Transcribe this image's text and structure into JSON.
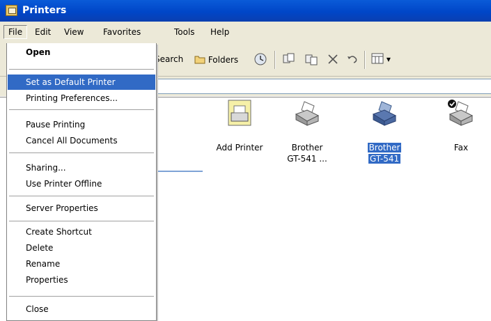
{
  "window": {
    "title": "Printers"
  },
  "menubar": [
    "File",
    "Edit",
    "View",
    "Favorites",
    "Tools",
    "Help"
  ],
  "toolbar": {
    "search": "Search",
    "folders": "Folders",
    "view_dropdown": "▾"
  },
  "file_menu": {
    "groups": [
      [
        "Open"
      ],
      [
        "Set as Default Printer",
        "Printing Preferences..."
      ],
      [
        "Pause Printing",
        "Cancel All Documents"
      ],
      [
        "Sharing...",
        "Use Printer Offline"
      ],
      [
        "Server Properties"
      ],
      [
        "Create Shortcut",
        "Delete",
        "Rename",
        "Properties"
      ],
      [
        "Close"
      ]
    ],
    "highlighted": "Set as Default Printer"
  },
  "items": [
    {
      "name": "Add Printer",
      "icon": "add-printer-icon"
    },
    {
      "name": "Brother GT-541 ...",
      "line1": "Brother",
      "line2": "GT-541 ...",
      "icon": "printer-icon"
    },
    {
      "name": "Brother GT-541",
      "line1": "Brother",
      "line2": "GT-541",
      "icon": "printer-icon",
      "selected": true
    },
    {
      "name": "Fax",
      "icon": "fax-icon",
      "badge": "default-checkmark"
    }
  ],
  "colors": {
    "title_bar": "#0a5bd8",
    "highlight": "#316ac5",
    "menubar": "#ece9d8"
  }
}
